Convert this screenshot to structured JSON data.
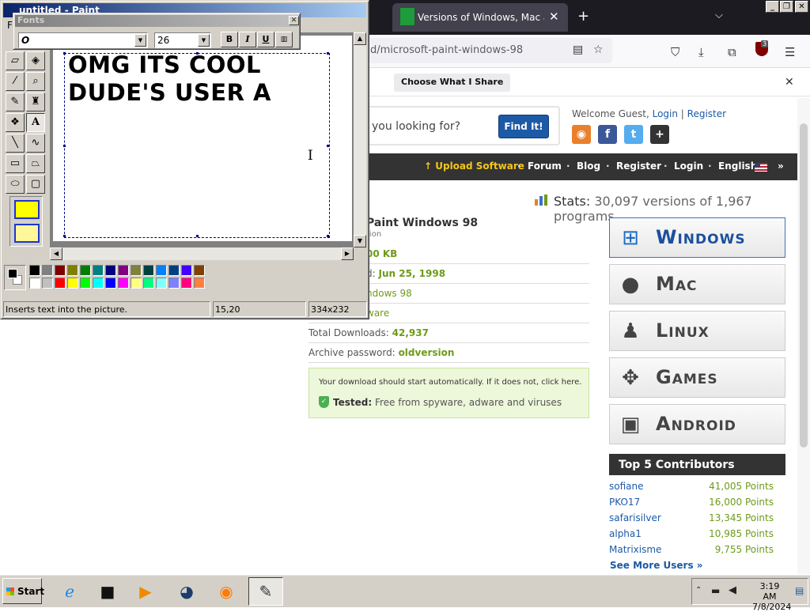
{
  "browser": {
    "tab_title": "Versions of Windows, Mac and",
    "url": "d/microsoft-paint-windows-98",
    "notification_button": "Choose What I Share",
    "ublock_badge": "3"
  },
  "site": {
    "search_placeholder": "you looking for?",
    "search_button": "Find It!",
    "welcome_text": "Welcome Guest,",
    "login_link": "Login",
    "register_link": "Register",
    "social": [
      "rss-icon",
      "facebook-icon",
      "twitter-icon",
      "google-plus-icon"
    ],
    "menu": {
      "upload": "Upload Software",
      "forum": "Forum",
      "blog": "Blog",
      "register": "Register",
      "login": "Login",
      "language": "English"
    },
    "stats_label": "Stats:",
    "stats_value": "30,097 versions of 1,967 programs",
    "app_title": "Paint Windows 98",
    "app_sub": "tion",
    "details": [
      {
        "label": "",
        "value": "00 KB"
      },
      {
        "label": "d:",
        "value": "Jun 25, 1998"
      },
      {
        "label": "",
        "value": "ndows 98"
      },
      {
        "label": "",
        "value": "ware"
      },
      {
        "label": "Total Downloads:",
        "value": "42,937"
      },
      {
        "label": "Archive password:",
        "value": "oldversion"
      }
    ],
    "download_notice": "Your download should start automatically. If it does not, click here.",
    "tested_label": "Tested:",
    "tested_text": "Free from spyware, adware and viruses",
    "os_buttons": [
      "Windows",
      "Mac",
      "Linux",
      "Games",
      "Android"
    ],
    "contributors_title": "Top 5 Contributors",
    "contributors": [
      {
        "name": "sofiane",
        "points": "41,005 Points"
      },
      {
        "name": "PKO17",
        "points": "16,000 Points"
      },
      {
        "name": "safarisilver",
        "points": "13,345 Points"
      },
      {
        "name": "alpha1",
        "points": "10,985 Points"
      },
      {
        "name": "Matrixisme",
        "points": "9,755 Points"
      }
    ],
    "see_more": "See More Users »"
  },
  "paint": {
    "title": "untitled - Paint",
    "menu_first": "F",
    "typed_line1": "OMG ITS COOL",
    "typed_line2": "DUDE'S USER A",
    "status_text": "Inserts text into the picture.",
    "status_coords": "15,20",
    "status_size": "334x232",
    "palette_top": [
      "#000000",
      "#808080",
      "#800000",
      "#808000",
      "#008000",
      "#008080",
      "#000080",
      "#800080",
      "#808040",
      "#004040",
      "#0080ff",
      "#004080",
      "#4000ff",
      "#804000"
    ],
    "palette_bottom": [
      "#ffffff",
      "#c0c0c0",
      "#ff0000",
      "#ffff00",
      "#00ff00",
      "#00ffff",
      "#0000ff",
      "#ff00ff",
      "#ffff80",
      "#00ff80",
      "#80ffff",
      "#8080ff",
      "#ff0080",
      "#ff8040"
    ]
  },
  "fonts_toolbar": {
    "title": "Fonts",
    "font_name": "O",
    "font_size": "26",
    "bold": "B",
    "italic": "I",
    "underline": "U"
  },
  "taskbar": {
    "start": "Start",
    "time": "3:19 AM",
    "date": "7/8/2024"
  }
}
